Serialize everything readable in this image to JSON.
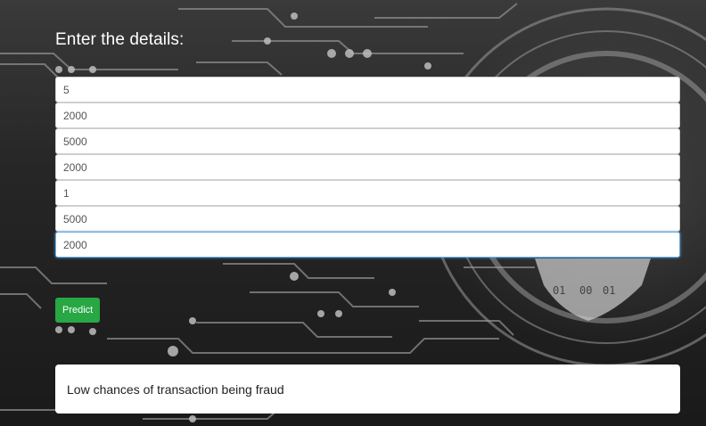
{
  "form": {
    "heading": "Enter the details:",
    "fields": [
      {
        "value": "5"
      },
      {
        "value": "2000"
      },
      {
        "value": "5000"
      },
      {
        "value": "2000"
      },
      {
        "value": "1"
      },
      {
        "value": "5000"
      },
      {
        "value": "2000"
      }
    ],
    "predict_label": "Predict"
  },
  "result": {
    "text": "Low chances of transaction being fraud"
  },
  "background": {
    "description_icon": "circuit-board-background",
    "colors": {
      "dark": "#1b1b1b",
      "trace": "#8a8a8a",
      "button": "#28a745",
      "focus": "#66afe9"
    }
  }
}
